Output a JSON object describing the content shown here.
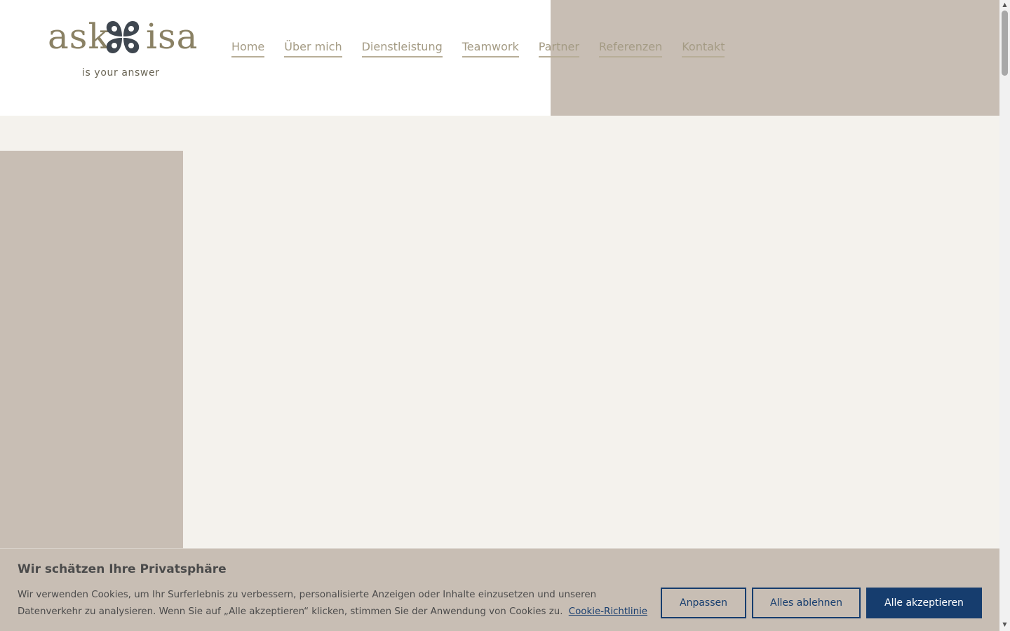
{
  "brand": {
    "word_left": "ask",
    "word_right": "isa",
    "tagline": "is your answer",
    "icon": "four-petal-flower-icon",
    "color_text": "#8a8164",
    "color_icon": "#3f4750"
  },
  "nav": {
    "items": [
      {
        "label": "Home"
      },
      {
        "label": "Über mich"
      },
      {
        "label": "Dienstleistung"
      },
      {
        "label": "Teamwork"
      },
      {
        "label": "Partner"
      },
      {
        "label": "Referenzen"
      },
      {
        "label": "Kontakt"
      }
    ]
  },
  "colors": {
    "accent_beige": "#c8beb4",
    "page_bg": "#f4f2ed",
    "button_navy": "#163d6e"
  },
  "cookie": {
    "title": "Wir schätzen Ihre Privatsphäre",
    "text": "Wir verwenden Cookies, um Ihr Surferlebnis zu verbessern, personalisierte Anzeigen oder Inhalte einzusetzen und unseren Datenverkehr zu analysieren. Wenn Sie auf „Alle akzeptieren“ klicken, stimmen Sie der Anwendung von Cookies zu.",
    "link_label": "Cookie-Richtlinie",
    "buttons": {
      "customize": "Anpassen",
      "reject": "Alles ablehnen",
      "accept": "Alle akzeptieren"
    }
  }
}
